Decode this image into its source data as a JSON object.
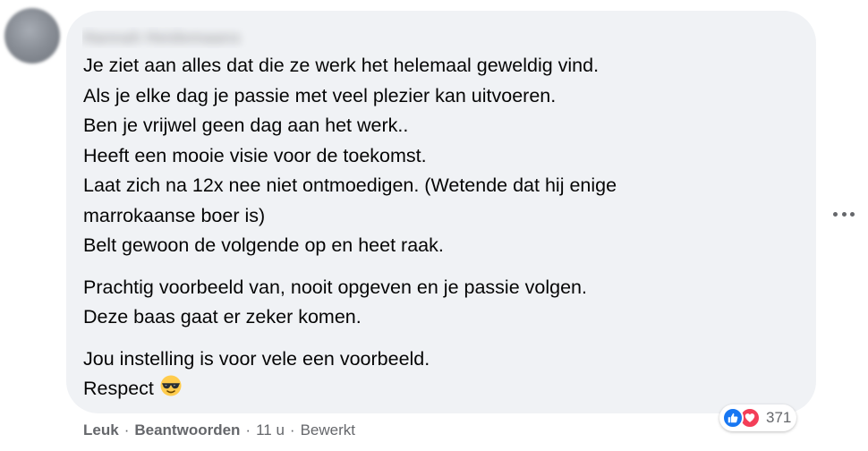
{
  "comment": {
    "author_name": "Hannah Heidemaans",
    "paragraphs": [
      [
        "Je ziet aan alles dat die ze werk het helemaal geweldig vind.",
        "Als je elke dag je passie met veel plezier kan uitvoeren.",
        "Ben je vrijwel geen dag aan het werk..",
        "Heeft een mooie visie voor de toekomst.",
        "Laat zich na 12x nee niet ontmoedigen. (Wetende dat hij enige",
        "marrokaanse boer is)",
        "Belt gewoon de volgende op en heet raak."
      ],
      [
        "Prachtig voorbeeld van, nooit opgeven en je passie volgen.",
        "Deze baas gaat er zeker komen."
      ],
      [
        "Jou instelling is voor vele een voorbeeld.",
        "Respect"
      ]
    ],
    "emoji_icon": "sunglasses-emoji"
  },
  "actions": {
    "like_label": "Leuk",
    "reply_label": "Beantwoorden",
    "time": "11 u",
    "edited_label": "Bewerkt",
    "separator": "·"
  },
  "reactions": {
    "icons": [
      "like-icon",
      "love-icon"
    ],
    "count": "371"
  },
  "colors": {
    "bubble_bg": "#f0f2f5",
    "text": "#050505",
    "secondary_text": "#65676b",
    "like_blue": "#1877f2",
    "love_red": "#f33e58"
  }
}
